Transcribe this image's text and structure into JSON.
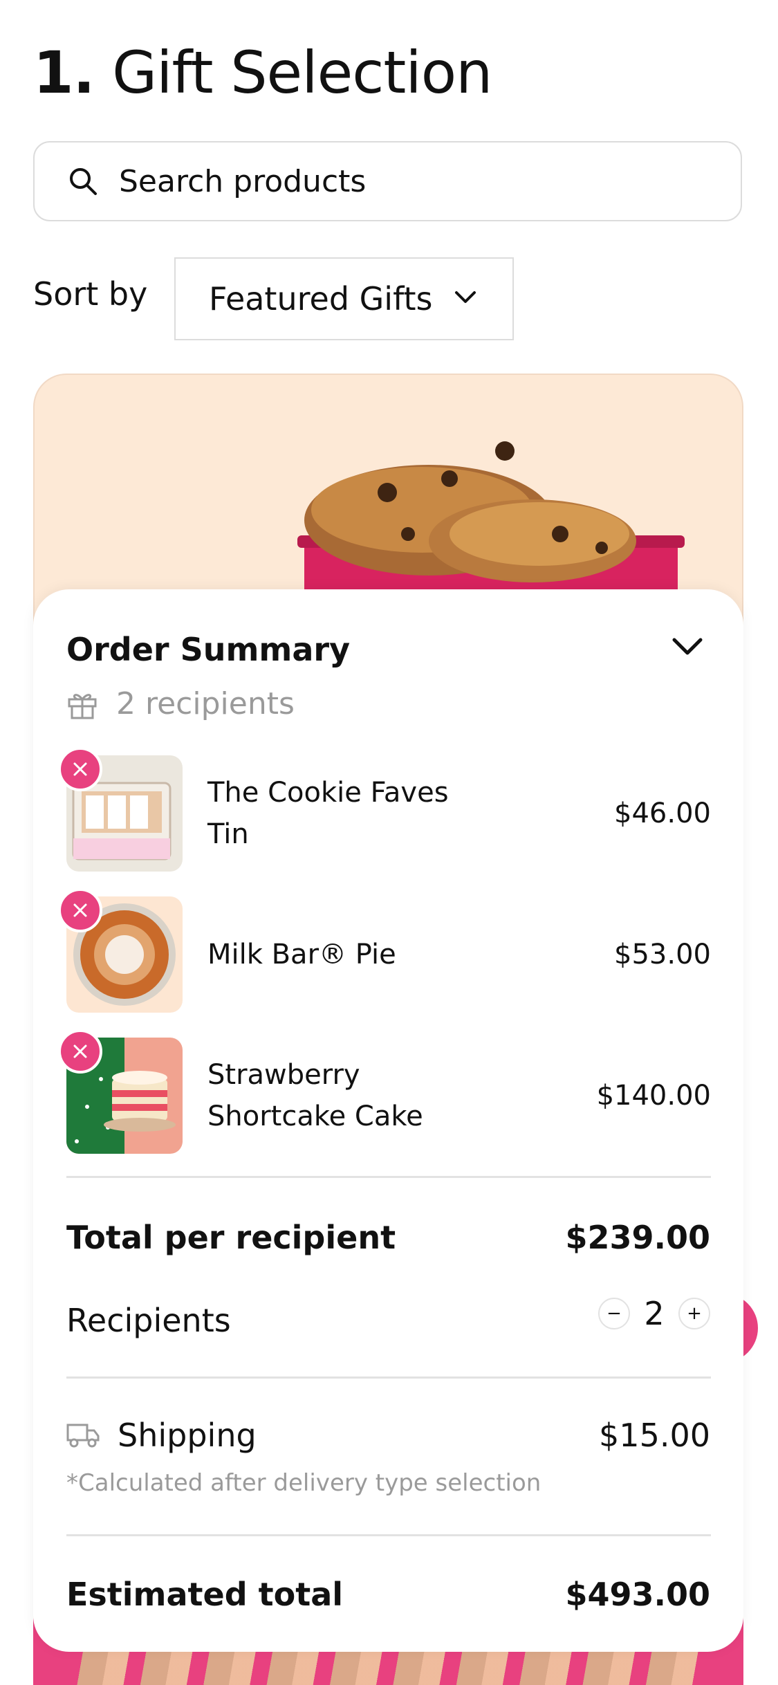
{
  "page": {
    "title_number": "1.",
    "title_text": "Gift Selection"
  },
  "search": {
    "placeholder": "Search products",
    "icon": "search-icon"
  },
  "sort": {
    "label": "Sort by",
    "selected": "Featured Gifts"
  },
  "colors": {
    "accent": "#e8417f",
    "hero_bg": "#fde9d6",
    "muted_text": "#9a9a9a"
  },
  "order_summary": {
    "title": "Order Summary",
    "recipients_text": "2 recipients",
    "items": [
      {
        "name": "The Cookie Faves Tin",
        "price": "$46.00"
      },
      {
        "name": "Milk Bar® Pie",
        "price": "$53.00"
      },
      {
        "name": "Strawberry Shortcake Cake",
        "price": "$140.00"
      }
    ],
    "total_per_recipient_label": "Total per recipient",
    "total_per_recipient_value": "$239.00",
    "recipients_label": "Recipients",
    "recipients_count": "2",
    "shipping_label": "Shipping",
    "shipping_value": "$15.00",
    "shipping_note": "*Calculated after delivery type selection",
    "estimated_total_label": "Estimated total",
    "estimated_total_value": "$493.00"
  }
}
